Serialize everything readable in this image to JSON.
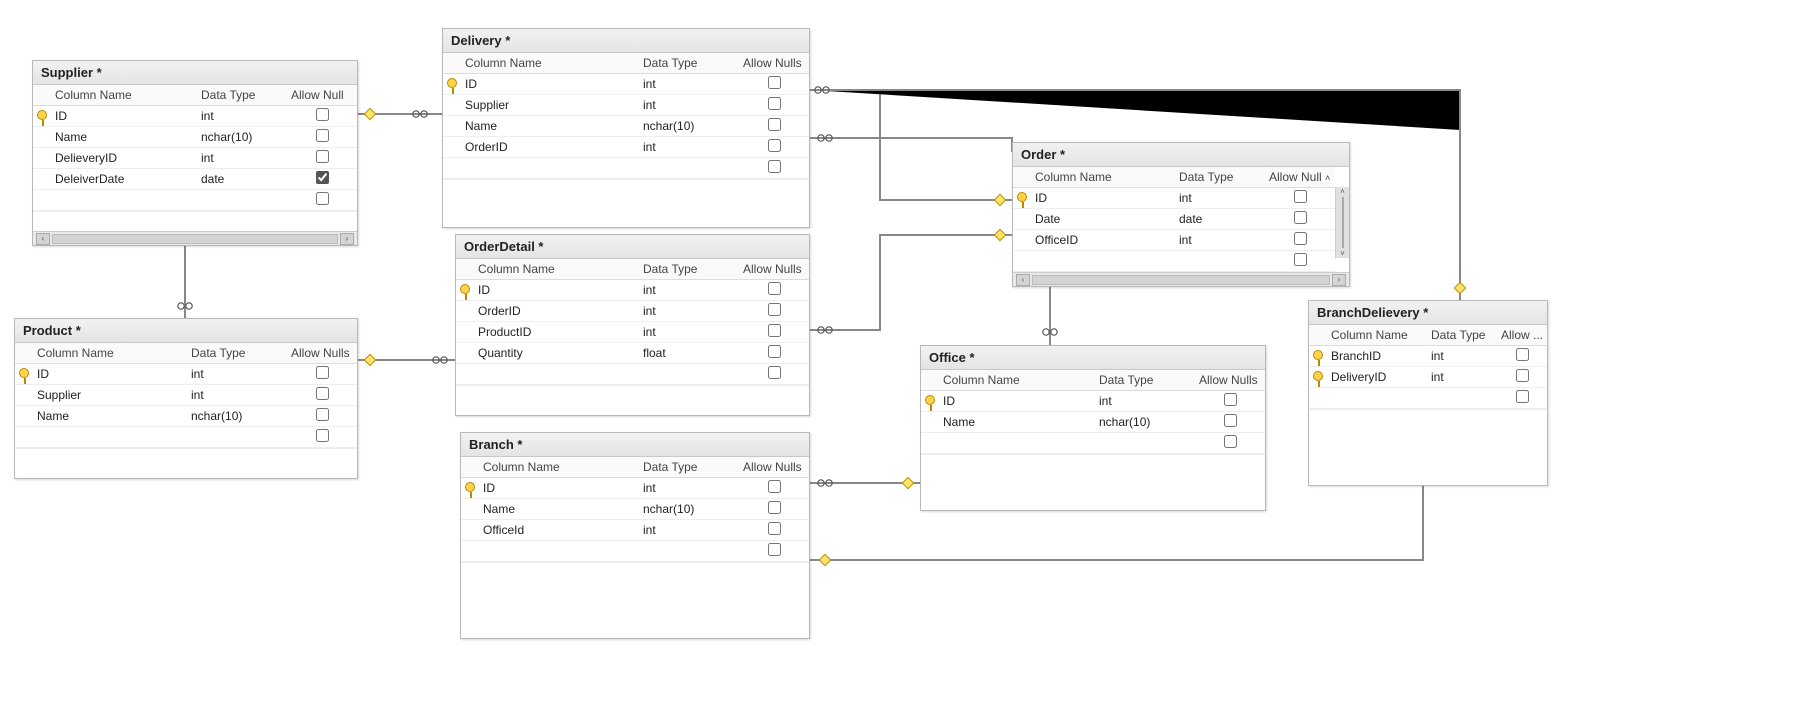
{
  "headers": {
    "col": "Column Name",
    "type": "Data Type",
    "nulls": "Allow Nulls",
    "nullsShort": "Allow Null",
    "nullsEllip": "Allow ..."
  },
  "tables": {
    "supplier": {
      "title": "Supplier *",
      "rows": [
        {
          "pk": true,
          "name": "ID",
          "type": "int",
          "null": false
        },
        {
          "pk": false,
          "name": "Name",
          "type": "nchar(10)",
          "null": false
        },
        {
          "pk": false,
          "name": "DelieveryID",
          "type": "int",
          "null": false
        },
        {
          "pk": false,
          "name": "DeleiverDate",
          "type": "date",
          "null": true
        }
      ]
    },
    "delivery": {
      "title": "Delivery *",
      "rows": [
        {
          "pk": true,
          "name": "ID",
          "type": "int",
          "null": false
        },
        {
          "pk": false,
          "name": "Supplier",
          "type": "int",
          "null": false
        },
        {
          "pk": false,
          "name": "Name",
          "type": "nchar(10)",
          "null": false
        },
        {
          "pk": false,
          "name": "OrderID",
          "type": "int",
          "null": false
        }
      ]
    },
    "order": {
      "title": "Order *",
      "rows": [
        {
          "pk": true,
          "name": "ID",
          "type": "int",
          "null": false
        },
        {
          "pk": false,
          "name": "Date",
          "type": "date",
          "null": false
        },
        {
          "pk": false,
          "name": "OfficeID",
          "type": "int",
          "null": false
        }
      ]
    },
    "product": {
      "title": "Product *",
      "rows": [
        {
          "pk": true,
          "name": "ID",
          "type": "int",
          "null": false
        },
        {
          "pk": false,
          "name": "Supplier",
          "type": "int",
          "null": false
        },
        {
          "pk": false,
          "name": "Name",
          "type": "nchar(10)",
          "null": false
        }
      ]
    },
    "orderdetail": {
      "title": "OrderDetail *",
      "rows": [
        {
          "pk": true,
          "name": "ID",
          "type": "int",
          "null": false
        },
        {
          "pk": false,
          "name": "OrderID",
          "type": "int",
          "null": false
        },
        {
          "pk": false,
          "name": "ProductID",
          "type": "int",
          "null": false
        },
        {
          "pk": false,
          "name": "Quantity",
          "type": "float",
          "null": false
        }
      ]
    },
    "office": {
      "title": "Office *",
      "rows": [
        {
          "pk": true,
          "name": "ID",
          "type": "int",
          "null": false
        },
        {
          "pk": false,
          "name": "Name",
          "type": "nchar(10)",
          "null": false
        }
      ]
    },
    "branch": {
      "title": "Branch *",
      "rows": [
        {
          "pk": true,
          "name": "ID",
          "type": "int",
          "null": false
        },
        {
          "pk": false,
          "name": "Name",
          "type": "nchar(10)",
          "null": false
        },
        {
          "pk": false,
          "name": "OfficeId",
          "type": "int",
          "null": false
        }
      ]
    },
    "branchdelivery": {
      "title": "BranchDelievery *",
      "rows": [
        {
          "pk": true,
          "name": "BranchID",
          "type": "int",
          "null": false
        },
        {
          "pk": true,
          "name": "DeliveryID",
          "type": "int",
          "null": false
        }
      ]
    }
  },
  "relationships": [
    {
      "from": "supplier",
      "to": "delivery"
    },
    {
      "from": "supplier",
      "to": "product"
    },
    {
      "from": "product",
      "to": "orderdetail"
    },
    {
      "from": "delivery",
      "to": "order"
    },
    {
      "from": "orderdetail",
      "to": "order"
    },
    {
      "from": "order",
      "to": "office"
    },
    {
      "from": "branch",
      "to": "office"
    },
    {
      "from": "order",
      "to": "branchdelivery"
    },
    {
      "from": "branch",
      "to": "branchdelivery"
    },
    {
      "from": "delivery",
      "to": "branchdelivery"
    }
  ]
}
